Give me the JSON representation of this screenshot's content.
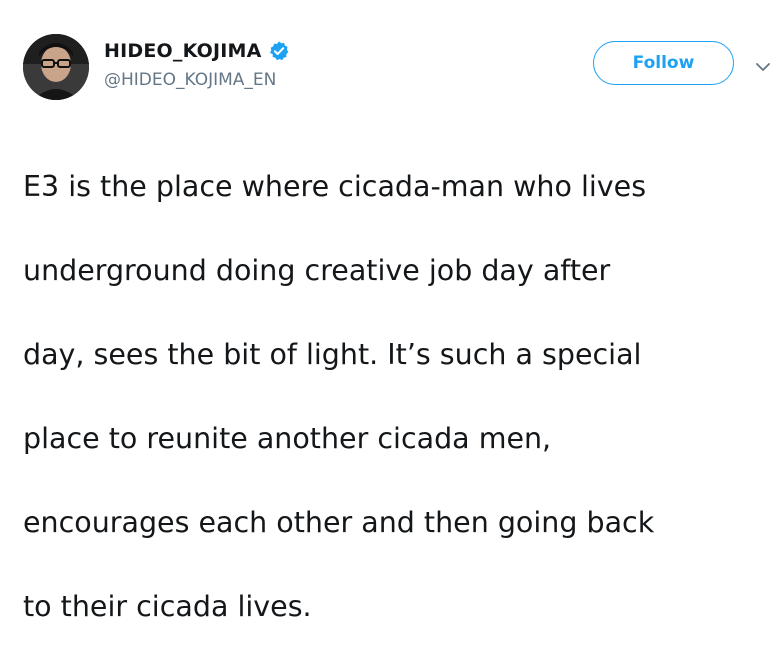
{
  "tweet": {
    "author": {
      "display_name": "HIDEO_KOJIMA",
      "handle": "@HIDEO_KOJIMA_EN",
      "verified": true,
      "avatar_icon": "user-avatar"
    },
    "follow_label": "Follow",
    "menu_icon": "chevron-down-icon",
    "text_lines": [
      "E3 is the place where cicada-man who lives",
      "underground doing creative job day after",
      "day, sees the bit of light. It’s such a special",
      "place to reunite another cicada men,",
      "encourages each other and then going back",
      "to their cicada lives."
    ]
  },
  "colors": {
    "accent": "#1da1f2",
    "text_primary": "#14171a",
    "text_secondary": "#657786",
    "background": "#ffffff"
  }
}
